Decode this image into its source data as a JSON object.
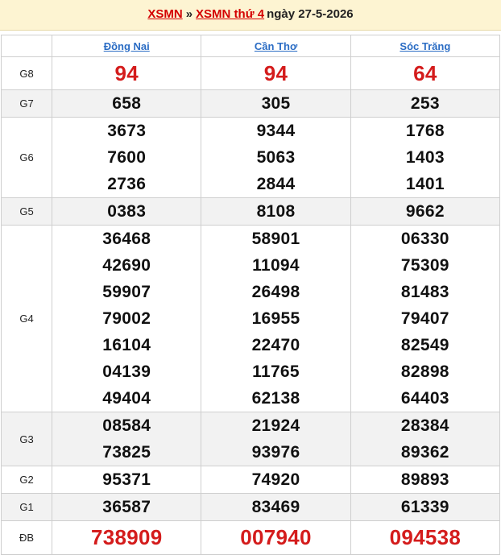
{
  "header": {
    "link1": "XSMN",
    "separator": "»",
    "link2": "XSMN thứ 4",
    "date": "ngày 27-5-2026"
  },
  "provinces": [
    "Đồng Nai",
    "Cần Thơ",
    "Sóc Trăng"
  ],
  "rows": [
    {
      "label": "G8",
      "values": [
        [
          "94"
        ],
        [
          "94"
        ],
        [
          "64"
        ]
      ]
    },
    {
      "label": "G7",
      "values": [
        [
          "658"
        ],
        [
          "305"
        ],
        [
          "253"
        ]
      ]
    },
    {
      "label": "G6",
      "values": [
        [
          "3673",
          "7600",
          "2736"
        ],
        [
          "9344",
          "5063",
          "2844"
        ],
        [
          "1768",
          "1403",
          "1401"
        ]
      ]
    },
    {
      "label": "G5",
      "values": [
        [
          "0383"
        ],
        [
          "8108"
        ],
        [
          "9662"
        ]
      ]
    },
    {
      "label": "G4",
      "values": [
        [
          "36468",
          "42690",
          "59907",
          "79002",
          "16104",
          "04139",
          "49404"
        ],
        [
          "58901",
          "11094",
          "26498",
          "16955",
          "22470",
          "11765",
          "62138"
        ],
        [
          "06330",
          "75309",
          "81483",
          "79407",
          "82549",
          "82898",
          "64403"
        ]
      ]
    },
    {
      "label": "G3",
      "values": [
        [
          "08584",
          "73825"
        ],
        [
          "21924",
          "93976"
        ],
        [
          "28384",
          "89362"
        ]
      ]
    },
    {
      "label": "G2",
      "values": [
        [
          "95371"
        ],
        [
          "74920"
        ],
        [
          "89893"
        ]
      ]
    },
    {
      "label": "G1",
      "values": [
        [
          "36587"
        ],
        [
          "83469"
        ],
        [
          "61339"
        ]
      ]
    },
    {
      "label": "ĐB",
      "values": [
        [
          "738909"
        ],
        [
          "007940"
        ],
        [
          "094538"
        ]
      ]
    }
  ],
  "colors": {
    "header_bg": "#fdf4d2",
    "link_red": "#d40000",
    "province_blue": "#2a6cc4",
    "prize_red": "#d41c1c",
    "shade": "#f2f2f2"
  }
}
